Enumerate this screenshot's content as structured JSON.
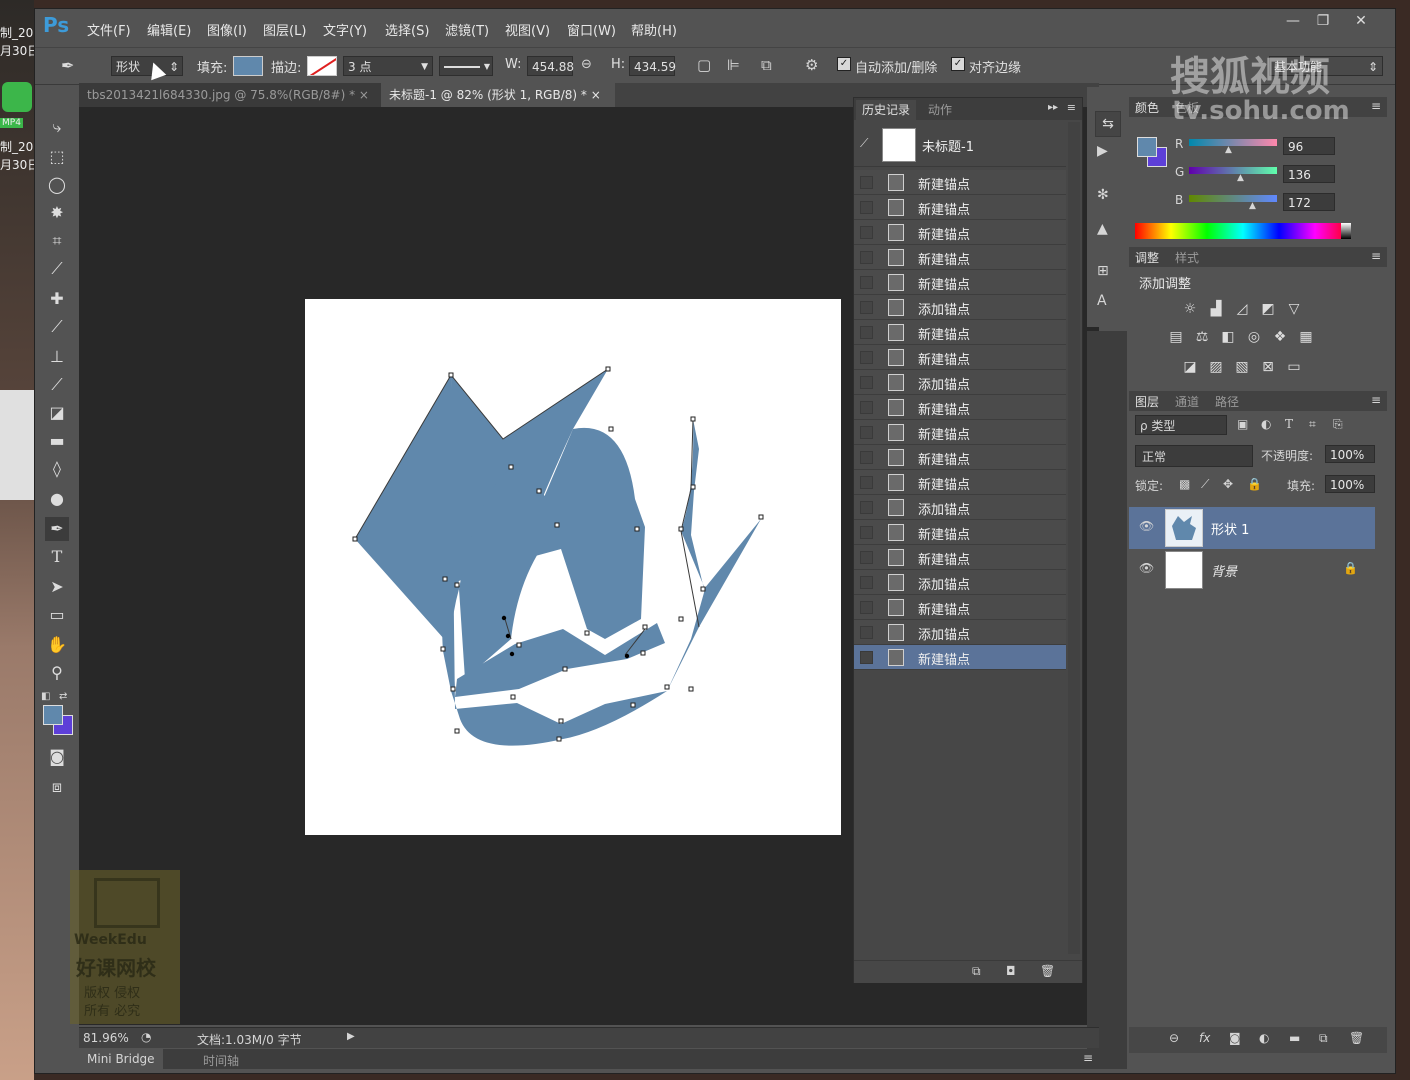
{
  "desktop": {
    "texts": [
      "制_20",
      "月30日",
      "MP4",
      "制_20",
      "月30日"
    ]
  },
  "app": {
    "logo": "Ps"
  },
  "menu": [
    "文件(F)",
    "编辑(E)",
    "图像(I)",
    "图层(L)",
    "文字(Y)",
    "选择(S)",
    "滤镜(T)",
    "视图(V)",
    "窗口(W)",
    "帮助(H)"
  ],
  "window_controls": {
    "minimize": "—",
    "restore": "❐",
    "close": "✕"
  },
  "options": {
    "mode": "形状",
    "fill_label": "填充:",
    "stroke_label": "描边:",
    "stroke_size": "3 点",
    "w_label": "W:",
    "w_value": "454.88",
    "h_label": "H:",
    "h_value": "434.59",
    "auto_add": "自动添加/删除",
    "align_edges": "对齐边缘",
    "workspace": "基本功能"
  },
  "tabs": [
    {
      "label": "tbs2013421l684330.jpg @ 75.8%(RGB/8#) *",
      "close": "×"
    },
    {
      "label": "未标题-1 @ 82% (形状 1, RGB/8) *",
      "close": "×"
    }
  ],
  "history": {
    "tab1": "历史记录",
    "tab2": "动作",
    "snapshot": "未标题-1",
    "items": [
      "新建锚点",
      "新建锚点",
      "新建锚点",
      "新建锚点",
      "新建锚点",
      "添加锚点",
      "新建锚点",
      "新建锚点",
      "添加锚点",
      "新建锚点",
      "新建锚点",
      "新建锚点",
      "新建锚点",
      "添加锚点",
      "新建锚点",
      "新建锚点",
      "添加锚点",
      "新建锚点",
      "添加锚点",
      "新建锚点"
    ]
  },
  "color": {
    "tab1": "颜色",
    "tab2": "色板",
    "r_label": "R",
    "r": "96",
    "g_label": "G",
    "g": "136",
    "b_label": "B",
    "b": "172",
    "fg": "#6088ac",
    "bg": "#5d3fd8"
  },
  "adjust": {
    "tab1": "调整",
    "tab2": "样式",
    "title": "添加调整"
  },
  "layers": {
    "tab1": "图层",
    "tab2": "通道",
    "tab3": "路径",
    "filter": "ρ 类型",
    "blend": "正常",
    "opacity_label": "不透明度:",
    "opacity": "100%",
    "lock_label": "锁定:",
    "fill_label": "填充:",
    "fill": "100%",
    "rows": [
      {
        "name": "形状 1"
      },
      {
        "name": "背景"
      }
    ]
  },
  "status": {
    "zoom": "81.96%",
    "doc": "文档:1.03M/0 字节"
  },
  "bottom_tabs": [
    "Mini Bridge",
    "时间轴"
  ],
  "watermark": {
    "sohu1": "搜狐视频",
    "sohu2": "tv.sohu.com",
    "edu1": "WeekEdu",
    "edu2": "好课网校",
    "edu3": "版权 侵权",
    "edu4": "所有 必究"
  }
}
